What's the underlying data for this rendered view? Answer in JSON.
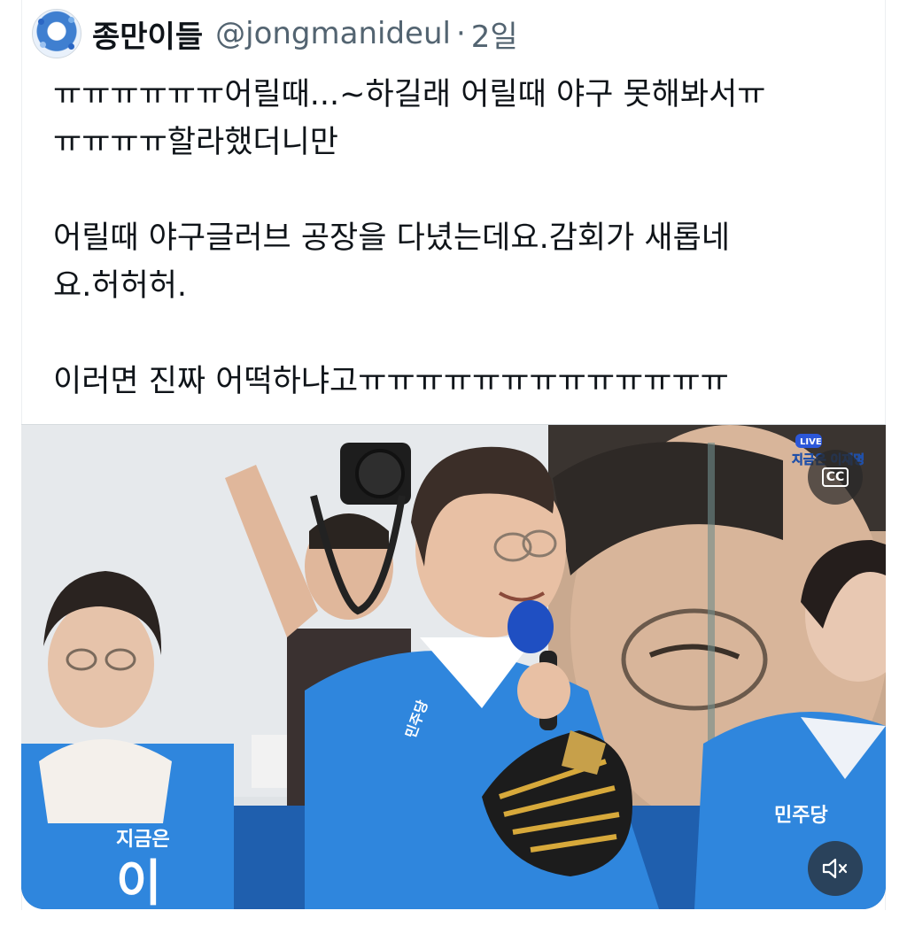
{
  "tweet": {
    "author_name": "종만이들",
    "handle": "@jongmanideul",
    "separator": "·",
    "time": "2일",
    "text_lines": [
      "ㅠㅠㅠㅠㅠㅠ어릴때...~하길래 어릴때 야구 못해봐서ㅠ",
      "ㅠㅠㅠㅠ할라했더니만",
      "",
      "어릴때 야구글러브 공장을 다녔는데요.감회가 새롭네",
      "요.허허허.",
      "",
      "이러면 진짜 어떡하냐고ㅠㅠㅠㅠㅠㅠㅠㅠㅠㅠㅠㅠㅠ"
    ]
  },
  "media": {
    "live_badge": "LIVE",
    "broadcast_caption": "지금은 이재명",
    "jacket_small_text": "민주당",
    "jacket_left_text": "지금은",
    "jacket_left_big": "이",
    "right_jacket_text": "민주당",
    "cc_label": "CC",
    "mute_icon": "speaker-muted-icon"
  },
  "colors": {
    "text": "#0f1419",
    "secondary": "#536471",
    "jacket_blue": "#2f86dd",
    "stage_blue": "#1f5fae"
  }
}
